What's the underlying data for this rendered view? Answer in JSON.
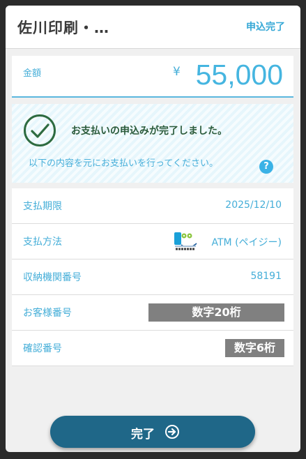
{
  "header": {
    "title": "佐川印刷・…",
    "status": "申込完了"
  },
  "amount": {
    "label": "金額",
    "currency": "¥",
    "value": "55,000"
  },
  "notice": {
    "message": "お支払いの申込みが完了しました。",
    "sub": "以下の内容を元にお支払いを行ってください。",
    "help": "?"
  },
  "details": {
    "due_label": "支払期限",
    "due_value": "2025/12/10",
    "method_label": "支払方法",
    "method_value": "ATM (ペイジー)",
    "institution_label": "収納機関番号",
    "institution_value": "58191",
    "customer_label": "お客様番号",
    "customer_value": "数字20桁",
    "confirm_label": "確認番号",
    "confirm_value": "数字6桁"
  },
  "done_button": {
    "label": "完了"
  },
  "colors": {
    "accent": "#45aed8",
    "button": "#1f6788",
    "success": "#2a5a3a",
    "mask": "#808080"
  },
  "icons": {
    "success": "check-circle-icon",
    "help": "question-icon",
    "payeasy": "pay-easy-logo",
    "arrow": "arrow-right-circle-icon"
  }
}
